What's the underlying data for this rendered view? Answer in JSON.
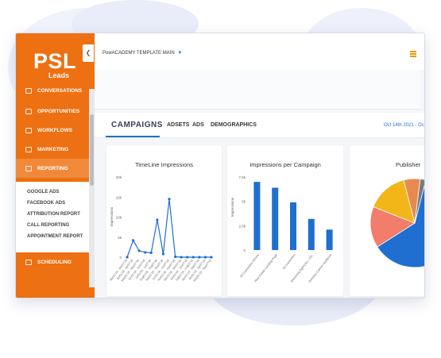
{
  "brand": {
    "name": "PSL",
    "tagline": "Leads"
  },
  "sidebar": {
    "items": [
      {
        "label": "CONVERSATIONS",
        "icon": "chat-icon"
      },
      {
        "label": "OPPORTUNITIES",
        "icon": "list-icon"
      },
      {
        "label": "WORKFLOWS",
        "icon": "sitemap-icon"
      },
      {
        "label": "MARKETING",
        "icon": "mail-icon"
      },
      {
        "label": "REPORTING",
        "icon": "chart-icon"
      },
      {
        "label": "SCHEDULING",
        "icon": "calendar-icon"
      }
    ],
    "sub_items": [
      {
        "label": "GOOGLE ADS"
      },
      {
        "label": "FACEBOOK ADS"
      },
      {
        "label": "ATTRIBUTION REPORT"
      },
      {
        "label": "CALL REPORTING"
      },
      {
        "label": "APPOINTMENT REPORT"
      }
    ]
  },
  "header": {
    "template_label": "PowACADEMY TEMPLATE MAIN"
  },
  "tabs": [
    {
      "label": "CAMPAIGNS"
    },
    {
      "label": "ADSETS"
    },
    {
      "label": "ADS"
    },
    {
      "label": "DEMOGRAPHICS"
    }
  ],
  "date_range": "Oct 14th 2021 - Oc",
  "cards": {
    "timeline": {
      "title": "TimeLine Impressions"
    },
    "per_campaign": {
      "title": "Impressions per Campaign"
    },
    "publisher": {
      "title": "Publisher"
    }
  },
  "chart_data": [
    {
      "type": "line",
      "title": "TimeLine Impressions",
      "ylabel": "Impressions",
      "ylim": [
        0,
        20000
      ],
      "yticks": [
        "0",
        "5k",
        "10k",
        "15k",
        "20k"
      ],
      "x": [
        "Mar01'18 - Mar07'18",
        "Apr01'18 - Apr07'18",
        "May01'18 - May07'18",
        "Jun01'18 - Jun07'18",
        "Jul01'18 - Jul07'18",
        "Aug01'18 - Aug07'18",
        "Sep01'18 - Sep07'18",
        "Oct01'18 - Oct07'18",
        "Nov01'18 - Nov07'18",
        "Dec01'18 - Dec07'18",
        "Jan01'19 - Jan07'19",
        "Feb01'19 - Feb07'19",
        "Mar01'19 - Mar07'19",
        "Apr01'19 - Apr07'19",
        "May01'19 - May07'19"
      ],
      "values": [
        0,
        4200,
        1600,
        1200,
        1100,
        9300,
        800,
        14500,
        100,
        0,
        0,
        0,
        0,
        0,
        0
      ],
      "color": "#1e6fd0"
    },
    {
      "type": "bar",
      "title": "Impressions per Campaign",
      "ylabel": "Impressions",
      "ylim": [
        0,
        7500
      ],
      "yticks": [
        "0",
        "2.5k",
        "5k",
        "7.5k"
      ],
      "categories": [
        "All Customers Winner",
        "Real Estate Landing Page",
        "All Customers",
        "Marketing Agencies - GS..",
        "Dentists Custom Audience"
      ],
      "values": [
        7000,
        6400,
        4900,
        3200,
        2100
      ],
      "color": "#1e6fd0"
    },
    {
      "type": "pie",
      "title": "Publisher",
      "values": [
        62,
        15,
        15,
        6,
        2
      ],
      "colors": [
        "#1e6fd0",
        "#f37d6b",
        "#f2b619",
        "#e88a4f",
        "#7a7a7a"
      ]
    }
  ]
}
